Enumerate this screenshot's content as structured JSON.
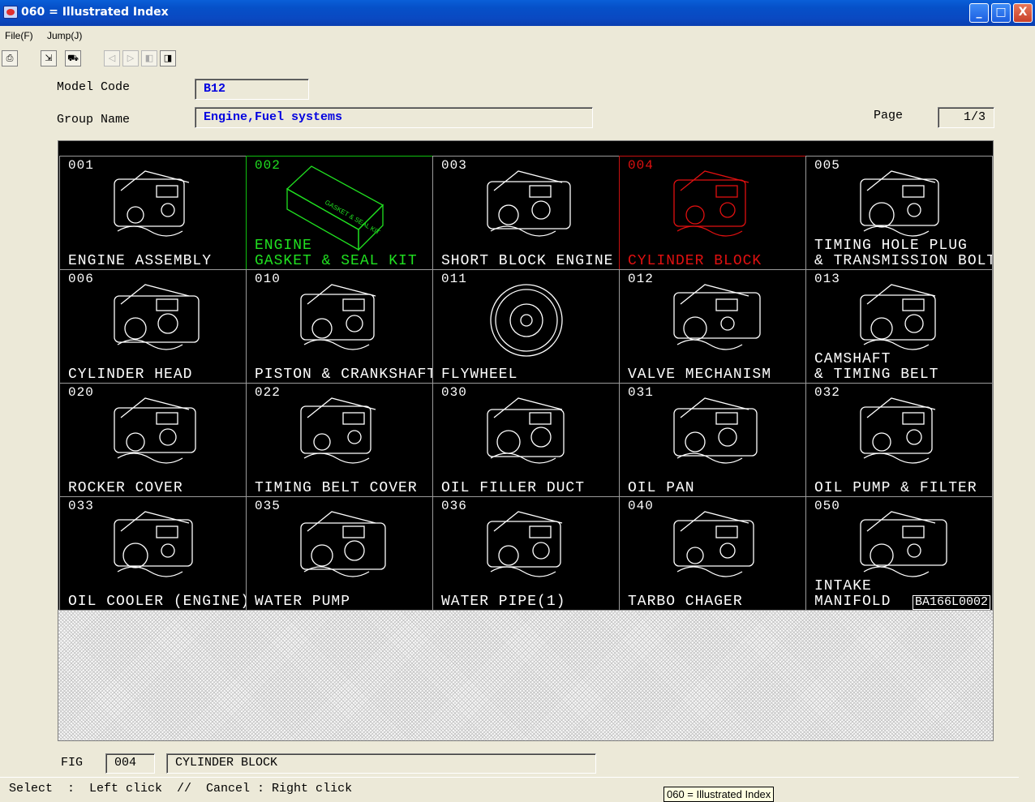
{
  "window": {
    "title": "060 = Illustrated Index",
    "buttons": {
      "minimize": "_",
      "maximize": "□",
      "close": "X"
    }
  },
  "menu": {
    "file": "File(F)",
    "jump": "Jump(J)"
  },
  "toolbar": {
    "tools": [
      {
        "name": "print-icon",
        "glyph": "⎙",
        "enabled": true
      },
      {
        "name": "open-figure-icon",
        "glyph": "⇲",
        "enabled": true
      },
      {
        "name": "car-icon",
        "glyph": "⛟",
        "enabled": true
      },
      {
        "name": "prev-group-icon",
        "glyph": "◁",
        "enabled": false
      },
      {
        "name": "next-group-icon",
        "glyph": "▷",
        "enabled": false
      },
      {
        "name": "prev-page-icon",
        "glyph": "◧",
        "enabled": false
      },
      {
        "name": "next-page-icon",
        "glyph": "◨",
        "enabled": true
      }
    ]
  },
  "header": {
    "model_code_label": "Model Code",
    "model_code": "B12",
    "group_name_label": "Group Name",
    "group_name": "Engine,Fuel systems",
    "page_label": "Page",
    "page": "1/3"
  },
  "figures": [
    {
      "code": "001",
      "name": "ENGINE ASSEMBLY",
      "state": "normal"
    },
    {
      "code": "002",
      "name": "ENGINE\nGASKET & SEAL KIT",
      "state": "hover"
    },
    {
      "code": "003",
      "name": "SHORT BLOCK ENGINE",
      "state": "normal"
    },
    {
      "code": "004",
      "name": "CYLINDER BLOCK",
      "state": "selected"
    },
    {
      "code": "005",
      "name": "TIMING HOLE PLUG\n& TRANSMISSION BOLT",
      "state": "normal"
    },
    {
      "code": "006",
      "name": "CYLINDER HEAD",
      "state": "normal"
    },
    {
      "code": "010",
      "name": "PISTON & CRANKSHAFT",
      "state": "normal"
    },
    {
      "code": "011",
      "name": "FLYWHEEL",
      "state": "normal"
    },
    {
      "code": "012",
      "name": "VALVE MECHANISM",
      "state": "normal"
    },
    {
      "code": "013",
      "name": "CAMSHAFT\n& TIMING BELT",
      "state": "normal"
    },
    {
      "code": "020",
      "name": "ROCKER COVER",
      "state": "normal"
    },
    {
      "code": "022",
      "name": "TIMING BELT COVER",
      "state": "normal"
    },
    {
      "code": "030",
      "name": "OIL FILLER DUCT",
      "state": "normal"
    },
    {
      "code": "031",
      "name": "OIL PAN",
      "state": "normal"
    },
    {
      "code": "032",
      "name": "OIL PUMP & FILTER",
      "state": "normal"
    },
    {
      "code": "033",
      "name": "OIL COOLER (ENGINE)",
      "state": "normal"
    },
    {
      "code": "035",
      "name": "WATER PUMP",
      "state": "normal"
    },
    {
      "code": "036",
      "name": "WATER PIPE(1)",
      "state": "normal"
    },
    {
      "code": "040",
      "name": "TARBO CHAGER",
      "state": "normal"
    },
    {
      "code": "050",
      "name": "INTAKE\nMANIFOLD",
      "state": "normal"
    }
  ],
  "kit_box_text": "GASKET & SEAL KIT",
  "reference_code": "BA166L0002",
  "footer": {
    "fig_label": "FIG",
    "fig_code": "004",
    "fig_name": "CYLINDER BLOCK",
    "status": "Select  :  Left click  //  Cancel : Right click",
    "tooltip": "060 = Illustrated Index"
  },
  "colors": {
    "selected": "#e01010",
    "hover": "#20e020",
    "line": "#ffffff",
    "field_text": "#0000e0",
    "titlebar": "#0a5fd8"
  }
}
